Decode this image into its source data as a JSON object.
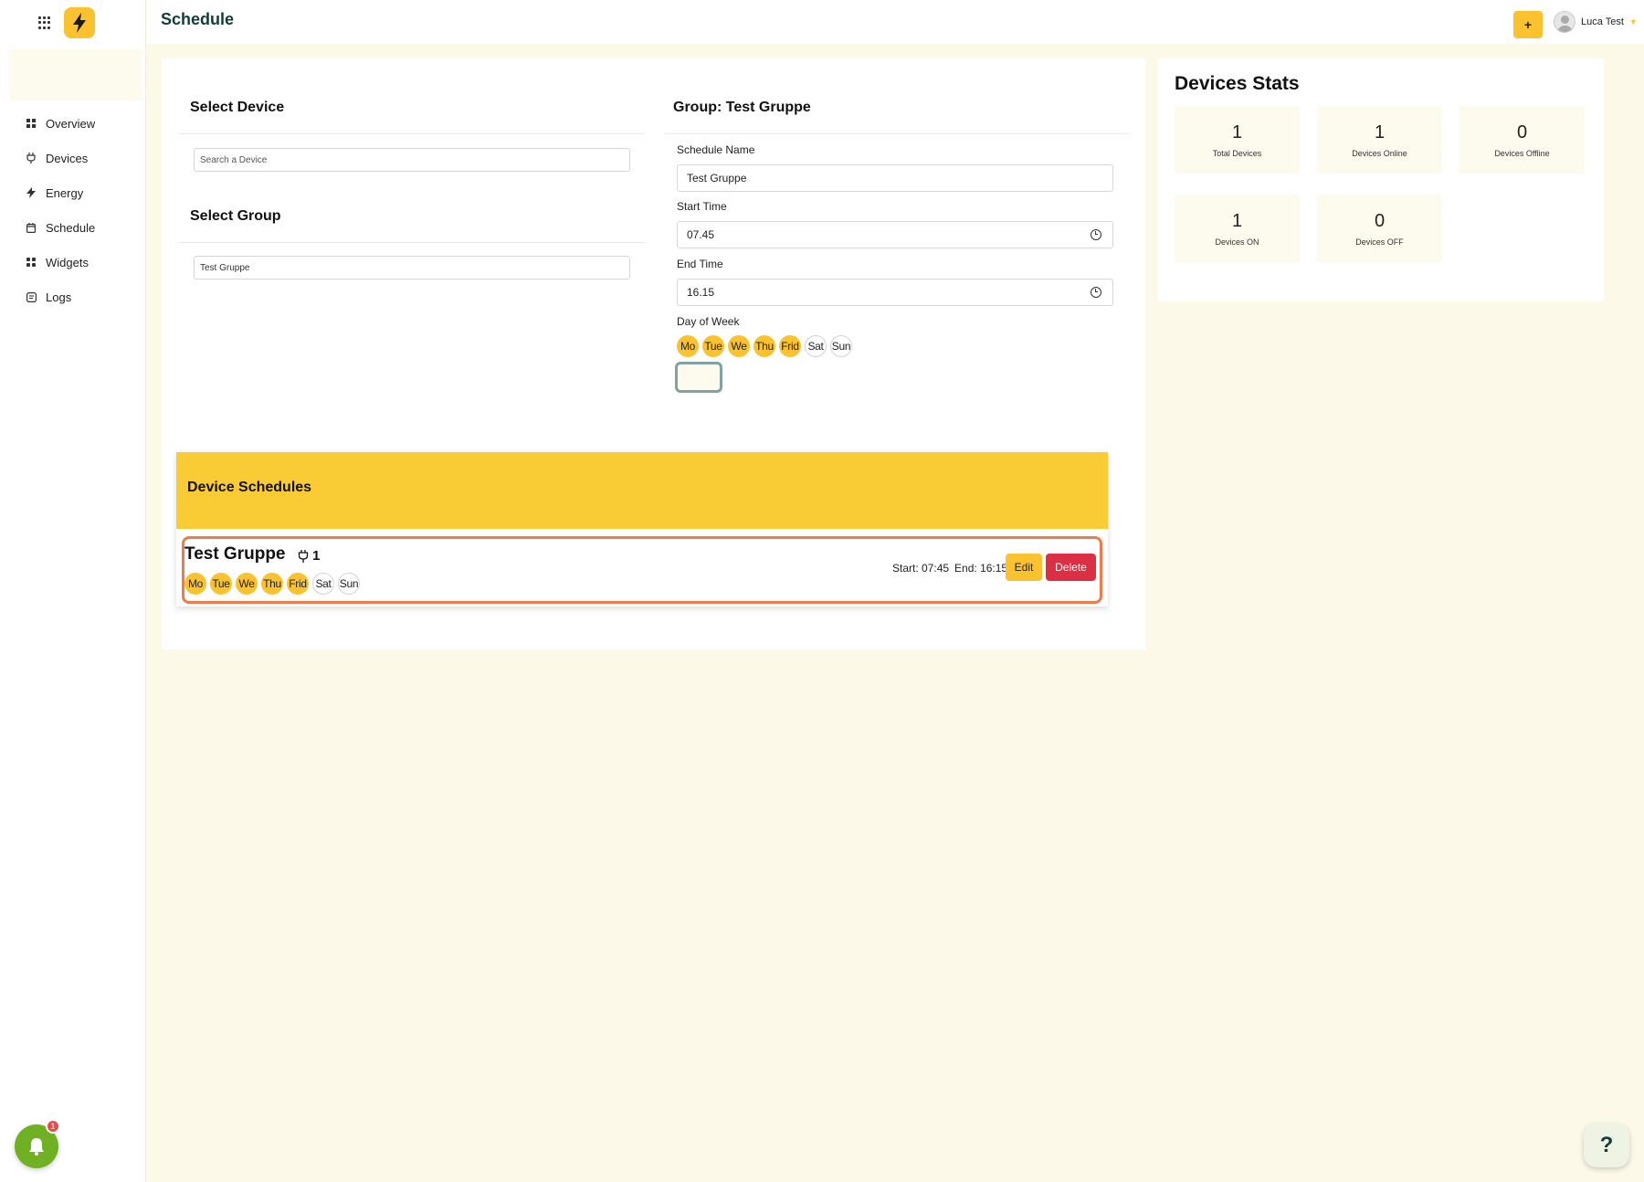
{
  "header": {
    "title": "Schedule",
    "add_label": "+",
    "user_name": "Luca Test"
  },
  "sidebar": {
    "items": [
      {
        "label": "Overview",
        "icon": "grid-icon"
      },
      {
        "label": "Devices",
        "icon": "plug-icon"
      },
      {
        "label": "Energy",
        "icon": "bolt-icon"
      },
      {
        "label": "Schedule",
        "icon": "calendar-icon"
      },
      {
        "label": "Widgets",
        "icon": "widgets-icon"
      },
      {
        "label": "Logs",
        "icon": "logs-icon"
      }
    ],
    "notifications": {
      "count": "1"
    }
  },
  "select_device": {
    "title": "Select Device",
    "placeholder": "Search a Device"
  },
  "select_group": {
    "title": "Select Group",
    "value": "Test Gruppe"
  },
  "group_form": {
    "title": "Group: Test Gruppe",
    "name_label": "Schedule Name",
    "name_value": "Test Gruppe",
    "start_label": "Start Time",
    "start_value": "07.45",
    "end_label": "End Time",
    "end_value": "16.15",
    "days_label": "Day of Week",
    "days": [
      {
        "label": "Mo",
        "active": true
      },
      {
        "label": "Tue",
        "active": true
      },
      {
        "label": "We",
        "active": true
      },
      {
        "label": "Thu",
        "active": true
      },
      {
        "label": "Frid",
        "active": true
      },
      {
        "label": "Sat",
        "active": false
      },
      {
        "label": "Sun",
        "active": false
      }
    ]
  },
  "device_schedules": {
    "title": "Device Schedules",
    "items": [
      {
        "name": "Test Gruppe",
        "device_count": "1",
        "start": "Start: 07:45",
        "end": "End: 16:15",
        "edit_label": "Edit",
        "delete_label": "Delete",
        "days": [
          {
            "label": "Mo",
            "active": true
          },
          {
            "label": "Tue",
            "active": true
          },
          {
            "label": "We",
            "active": true
          },
          {
            "label": "Thu",
            "active": true
          },
          {
            "label": "Frid",
            "active": true
          },
          {
            "label": "Sat",
            "active": false
          },
          {
            "label": "Sun",
            "active": false
          }
        ]
      }
    ]
  },
  "stats": {
    "title": "Devices Stats",
    "items": [
      {
        "value": "1",
        "label": "Total Devices"
      },
      {
        "value": "1",
        "label": "Devices Online"
      },
      {
        "value": "0",
        "label": "Devices Offline"
      },
      {
        "value": "1",
        "label": "Devices ON"
      },
      {
        "value": "0",
        "label": "Devices OFF"
      }
    ]
  },
  "help": {
    "label": "?"
  },
  "colors": {
    "accent": "#f9c22e",
    "danger": "#dc2f44",
    "brand_dark": "#0f3d3a",
    "highlight": "#f07a4a",
    "notification": "#6fb122"
  }
}
